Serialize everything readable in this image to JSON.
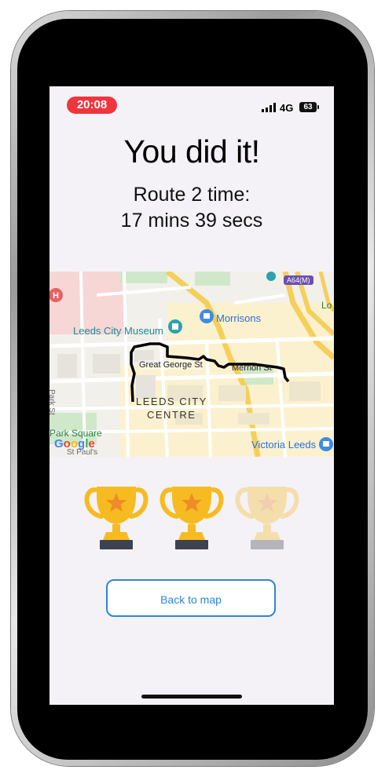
{
  "status_bar": {
    "time": "20:08",
    "network": "4G",
    "battery": "63"
  },
  "result": {
    "headline": "You did it!",
    "route_label": "Route 2 time:",
    "route_time": "17 mins 39 secs"
  },
  "map": {
    "labels": {
      "museum": "Leeds City Museum",
      "morrisons": "Morrisons",
      "great_george_st": "Great George St",
      "merrion_st": "Merrion St",
      "centre_line1": "LEEDS CITY",
      "centre_line2": "CENTRE",
      "park_square": "Park Square",
      "park_st": "Park St",
      "google": "Google",
      "victoria_leeds": "Victoria Leeds",
      "a64m": "A64(M)",
      "partial_lo": "Lo",
      "st_pauls": "St Paul's"
    },
    "route_color": "#000000"
  },
  "trophies": {
    "earned": 2,
    "total": 3,
    "gold_color": "#f6bb20",
    "star_color": "#f08a2a",
    "base_color": "#3d4250"
  },
  "actions": {
    "back_to_map": "Back to map"
  }
}
